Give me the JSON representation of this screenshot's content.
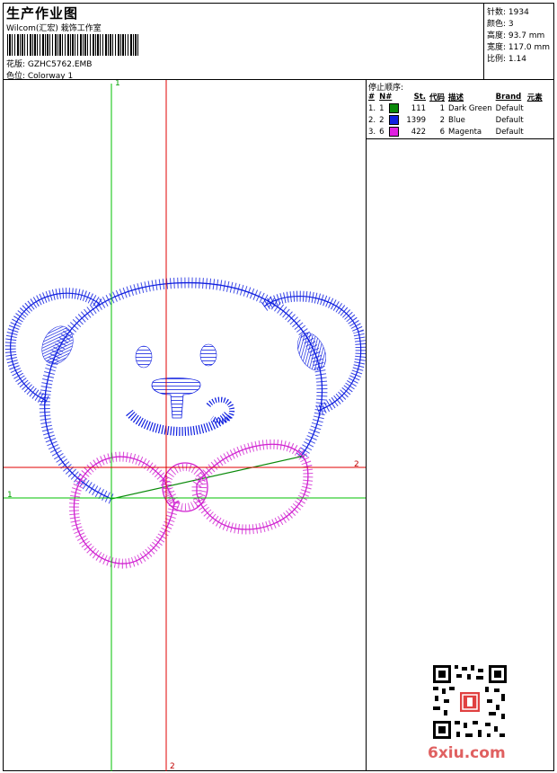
{
  "header": {
    "title": "生产作业图",
    "subtitle": "Wilcom(汇宏) 栽饰工作室",
    "design_label": "花版: GZHC5762.EMB",
    "colorway_label": "色位: Colorway 1"
  },
  "stats": {
    "stitches": "针数: 1934",
    "colors": "颜色: 3",
    "height": "高度: 93.7 mm",
    "width": "宽度: 117.0 mm",
    "scale": "比例: 1.14"
  },
  "stop_sequence": {
    "title": "停止顺序:",
    "headers": [
      "#",
      "N#",
      "St.",
      "代码",
      "描述",
      "Brand",
      "元素"
    ],
    "rows": [
      {
        "idx": "1.",
        "n": "1",
        "st": "111",
        "code": "1",
        "desc": "Dark Green",
        "brand": "Default",
        "color": "#0a8a0a"
      },
      {
        "idx": "2.",
        "n": "2",
        "st": "1399",
        "code": "2",
        "desc": "Blue",
        "brand": "Default",
        "color": "#1020e0"
      },
      {
        "idx": "3.",
        "n": "6",
        "st": "422",
        "code": "6",
        "desc": "Magenta",
        "brand": "Default",
        "color": "#e020e0"
      }
    ]
  },
  "guides": {
    "vertical_green_label": "1",
    "horizontal_green_label": "1",
    "vertical_red_label": "2",
    "horizontal_red_label": "2"
  },
  "colors": {
    "guide_green": "#00c000",
    "guide_red": "#e00000",
    "stitch_blue": "#1020e0",
    "stitch_green": "#0a8a0a",
    "stitch_magenta": "#d020d0"
  },
  "watermark": "6xiu.com"
}
